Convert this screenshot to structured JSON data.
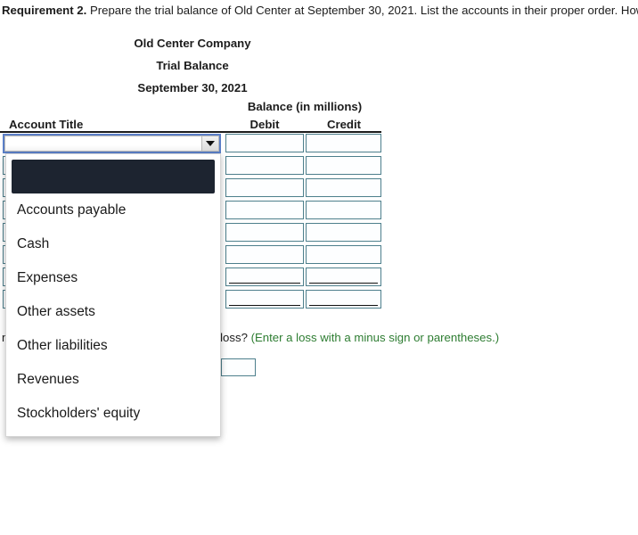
{
  "requirement": {
    "label": "Requirement 2.",
    "text": " Prepare the trial balance of Old Center at September 30, 2021. List the accounts in their proper order. How"
  },
  "statement_heading": {
    "company": "Old Center Company",
    "statement": "Trial Balance",
    "date": "September 30, 2021"
  },
  "table": {
    "headers": {
      "account_title": "Account Title",
      "balance_group": "Balance (in millions)",
      "debit": "Debit",
      "credit": "Credit"
    },
    "rows": [
      {
        "account": "",
        "debit": "",
        "credit": "",
        "rule": "none"
      },
      {
        "account": "",
        "debit": "",
        "credit": "",
        "rule": "none"
      },
      {
        "account": "",
        "debit": "",
        "credit": "",
        "rule": "none"
      },
      {
        "account": "",
        "debit": "",
        "credit": "",
        "rule": "none"
      },
      {
        "account": "",
        "debit": "",
        "credit": "",
        "rule": "none"
      },
      {
        "account": "",
        "debit": "",
        "credit": "",
        "rule": "none"
      },
      {
        "account": "",
        "debit": "",
        "credit": "",
        "rule": "single"
      },
      {
        "account": "",
        "debit": "",
        "credit": "",
        "rule": "double"
      }
    ]
  },
  "account_select": {
    "selected_value": "",
    "expanded": true,
    "arrow_icon": "chevron-down-icon",
    "options": [
      "",
      "Accounts payable",
      "Cash",
      "Expenses",
      "Other assets",
      "Other liabilities",
      "Revenues",
      "Stockholders' equity"
    ]
  },
  "net_income": {
    "question": "much was Old Center's net income or net loss?",
    "hint": "(Enter a loss with a minus sign or parentheses.)",
    "answer_value": ""
  },
  "colors": {
    "input_border": "#4d7f8c",
    "select_focus_border": "#5b7fc7",
    "dropdown_highlight": "#1d2430",
    "hint_green": "#2e7d32",
    "text": "#1c1c1c"
  }
}
